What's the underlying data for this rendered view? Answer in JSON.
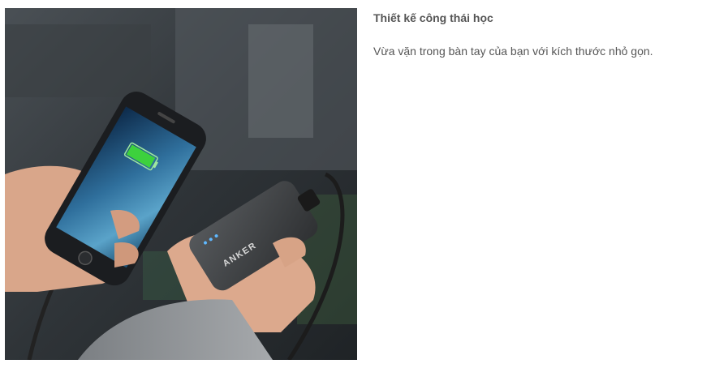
{
  "product_feature": {
    "title": "Thiết kế công thái học",
    "description": "Vừa vặn trong bàn tay của bạn với kích thước nhỏ gọn."
  },
  "photo": {
    "brand_label": "ANKER",
    "battery_color": "#3dd13d",
    "bank_color": "#3d3f41"
  }
}
